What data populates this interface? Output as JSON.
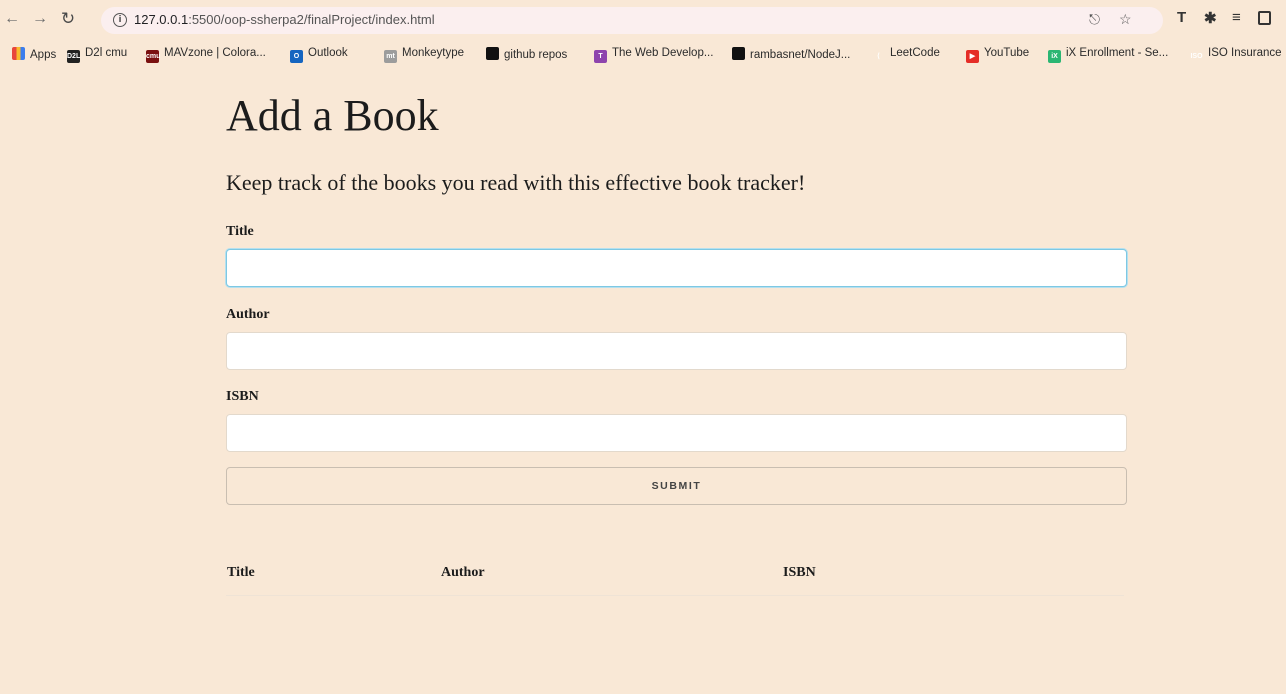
{
  "browser": {
    "url_host": "127.0.0.1",
    "url_path": ":5500/oop-ssherpa2/finalProject/index.html"
  },
  "bookmarks": [
    {
      "label": "Apps",
      "icon": "apps-grid-icon"
    },
    {
      "label": "D2l cmu",
      "icon": "d2l-icon"
    },
    {
      "label": "MAVzone | Colora...",
      "icon": "cmu-icon"
    },
    {
      "label": "Outlook",
      "icon": "outlook-icon"
    },
    {
      "label": "Monkeytype",
      "icon": "monkeytype-icon"
    },
    {
      "label": "github repos",
      "icon": "github-icon"
    },
    {
      "label": "The Web Develop...",
      "icon": "web-developer-icon"
    },
    {
      "label": "rambasnet/NodeJ...",
      "icon": "github-icon"
    },
    {
      "label": "LeetCode",
      "icon": "leetcode-icon"
    },
    {
      "label": "YouTube",
      "icon": "youtube-icon"
    },
    {
      "label": "iX Enrollment - Se...",
      "icon": "ix-icon"
    },
    {
      "label": "ISO Insurance",
      "icon": "iso-icon"
    }
  ],
  "page": {
    "title": "Add a Book",
    "subtitle": "Keep track of the books you read with this effective book tracker!",
    "form": {
      "title_label": "Title",
      "title_value": "",
      "author_label": "Author",
      "author_value": "",
      "isbn_label": "ISBN",
      "isbn_value": "",
      "submit_label": "SUBMIT"
    },
    "table": {
      "columns": [
        "Title",
        "Author",
        "ISBN"
      ],
      "rows": []
    }
  },
  "colors": {
    "page_background": "#f9e8d6",
    "focus_outline": "#7ec8e3"
  }
}
